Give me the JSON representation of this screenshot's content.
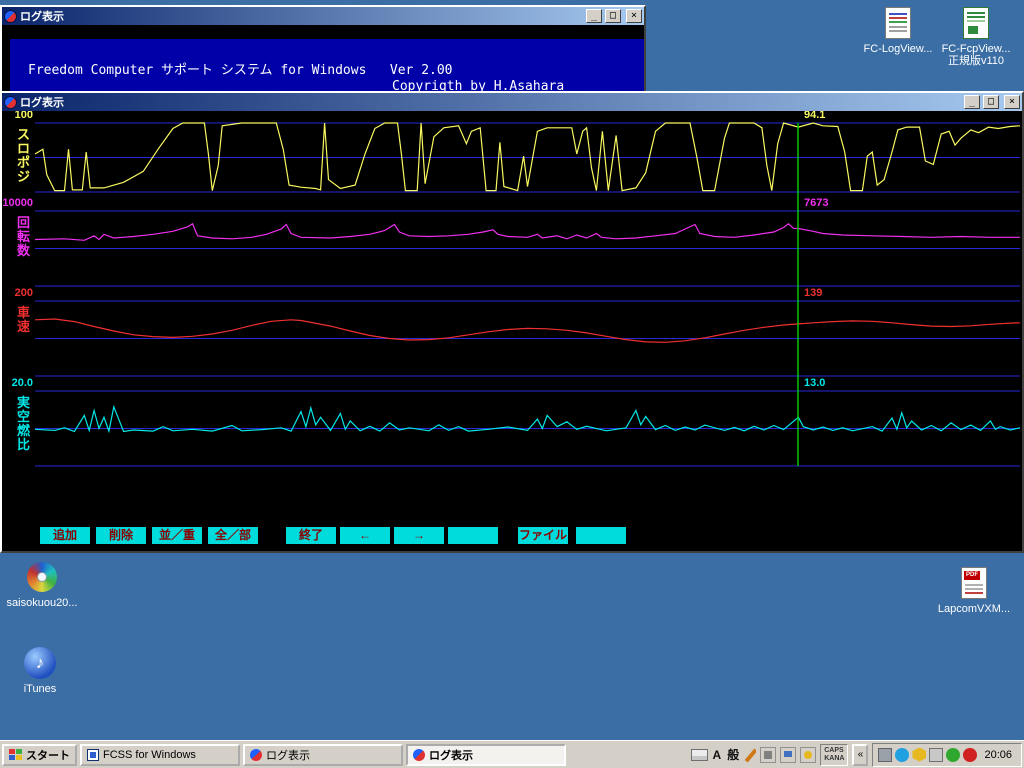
{
  "window_controls": {
    "minimize": "_",
    "maximize": "□",
    "close": "×"
  },
  "background_window": {
    "title": "ログ表示",
    "line1": "Freedom Computer サポート システム for Windows   Ver 2.00",
    "line2": "Copyrigth by H.Asahara"
  },
  "log_window": {
    "title": "ログ表示",
    "cursor_frac": 0.7746,
    "buttons": [
      "追加",
      "削除",
      "並／重",
      "全／部",
      "終了",
      "←",
      "→",
      "",
      "ファイル",
      ""
    ]
  },
  "chart_data": [
    {
      "type": "line",
      "name": "スロポジ",
      "axis_chars": [
        "ス",
        "ロ",
        "ポ",
        "ジ"
      ],
      "color": "#F8F860",
      "ymin": 0,
      "ymax": 100,
      "max_label": "100",
      "cursor_value": "94.1",
      "points": [
        [
          0,
          55
        ],
        [
          0.008,
          62
        ],
        [
          0.012,
          25
        ],
        [
          0.02,
          2
        ],
        [
          0.03,
          2
        ],
        [
          0.034,
          62
        ],
        [
          0.038,
          3
        ],
        [
          0.048,
          3
        ],
        [
          0.052,
          58
        ],
        [
          0.056,
          6
        ],
        [
          0.07,
          6
        ],
        [
          0.09,
          14
        ],
        [
          0.11,
          30
        ],
        [
          0.125,
          62
        ],
        [
          0.14,
          92
        ],
        [
          0.15,
          100
        ],
        [
          0.172,
          100
        ],
        [
          0.176,
          55
        ],
        [
          0.18,
          2
        ],
        [
          0.186,
          38
        ],
        [
          0.19,
          96
        ],
        [
          0.21,
          100
        ],
        [
          0.245,
          100
        ],
        [
          0.252,
          62
        ],
        [
          0.258,
          10
        ],
        [
          0.27,
          7
        ],
        [
          0.285,
          5
        ],
        [
          0.29,
          3
        ],
        [
          0.294,
          100
        ],
        [
          0.298,
          18
        ],
        [
          0.31,
          5
        ],
        [
          0.325,
          10
        ],
        [
          0.335,
          55
        ],
        [
          0.345,
          92
        ],
        [
          0.355,
          100
        ],
        [
          0.368,
          100
        ],
        [
          0.372,
          55
        ],
        [
          0.376,
          2
        ],
        [
          0.388,
          2
        ],
        [
          0.392,
          100
        ],
        [
          0.396,
          12
        ],
        [
          0.405,
          80
        ],
        [
          0.415,
          93
        ],
        [
          0.43,
          96
        ],
        [
          0.438,
          70
        ],
        [
          0.443,
          88
        ],
        [
          0.452,
          93
        ],
        [
          0.458,
          2
        ],
        [
          0.468,
          2
        ],
        [
          0.472,
          72
        ],
        [
          0.476,
          8
        ],
        [
          0.49,
          2
        ],
        [
          0.496,
          52
        ],
        [
          0.5,
          8
        ],
        [
          0.51,
          88
        ],
        [
          0.52,
          93
        ],
        [
          0.545,
          93
        ],
        [
          0.55,
          55
        ],
        [
          0.556,
          88
        ],
        [
          0.56,
          93
        ],
        [
          0.565,
          35
        ],
        [
          0.57,
          2
        ],
        [
          0.576,
          88
        ],
        [
          0.582,
          2
        ],
        [
          0.59,
          82
        ],
        [
          0.596,
          2
        ],
        [
          0.61,
          6
        ],
        [
          0.62,
          28
        ],
        [
          0.63,
          88
        ],
        [
          0.64,
          100
        ],
        [
          0.665,
          100
        ],
        [
          0.672,
          50
        ],
        [
          0.678,
          2
        ],
        [
          0.69,
          2
        ],
        [
          0.7,
          78
        ],
        [
          0.705,
          100
        ],
        [
          0.73,
          100
        ],
        [
          0.738,
          93
        ],
        [
          0.743,
          38
        ],
        [
          0.748,
          2
        ],
        [
          0.754,
          70
        ],
        [
          0.76,
          100
        ],
        [
          0.775,
          94
        ],
        [
          0.79,
          100
        ],
        [
          0.8,
          96
        ],
        [
          0.815,
          95
        ],
        [
          0.822,
          58
        ],
        [
          0.828,
          2
        ],
        [
          0.84,
          2
        ],
        [
          0.845,
          52
        ],
        [
          0.85,
          58
        ],
        [
          0.855,
          10
        ],
        [
          0.862,
          18
        ],
        [
          0.87,
          58
        ],
        [
          0.876,
          90
        ],
        [
          0.885,
          94
        ],
        [
          0.898,
          94
        ],
        [
          0.904,
          45
        ],
        [
          0.912,
          40
        ],
        [
          0.92,
          84
        ],
        [
          0.928,
          88
        ],
        [
          0.934,
          68
        ],
        [
          0.94,
          78
        ],
        [
          0.95,
          90
        ],
        [
          0.958,
          86
        ],
        [
          0.968,
          94
        ],
        [
          0.978,
          92
        ],
        [
          0.99,
          95
        ],
        [
          1,
          96
        ]
      ]
    },
    {
      "type": "line",
      "name": "回転数",
      "axis_chars": [
        "回",
        "転",
        "数"
      ],
      "color": "#F030F0",
      "ymin": 0,
      "ymax": 10000,
      "max_label": "10000",
      "cursor_value": "7673",
      "points": [
        [
          0,
          6200
        ],
        [
          0.03,
          6300
        ],
        [
          0.05,
          6100
        ],
        [
          0.06,
          6700
        ],
        [
          0.065,
          6200
        ],
        [
          0.07,
          6900
        ],
        [
          0.08,
          6400
        ],
        [
          0.1,
          6600
        ],
        [
          0.12,
          6900
        ],
        [
          0.14,
          7300
        ],
        [
          0.155,
          7900
        ],
        [
          0.16,
          8300
        ],
        [
          0.165,
          6700
        ],
        [
          0.18,
          6400
        ],
        [
          0.2,
          6300
        ],
        [
          0.22,
          6500
        ],
        [
          0.235,
          6900
        ],
        [
          0.25,
          7600
        ],
        [
          0.255,
          8200
        ],
        [
          0.26,
          7000
        ],
        [
          0.27,
          6500
        ],
        [
          0.3,
          6400
        ],
        [
          0.32,
          6600
        ],
        [
          0.34,
          6900
        ],
        [
          0.355,
          7400
        ],
        [
          0.365,
          8200
        ],
        [
          0.37,
          7200
        ],
        [
          0.38,
          6700
        ],
        [
          0.4,
          6600
        ],
        [
          0.42,
          6700
        ],
        [
          0.44,
          6900
        ],
        [
          0.455,
          7200
        ],
        [
          0.465,
          7500
        ],
        [
          0.47,
          6900
        ],
        [
          0.48,
          6600
        ],
        [
          0.5,
          6500
        ],
        [
          0.51,
          6900
        ],
        [
          0.515,
          6400
        ],
        [
          0.53,
          6700
        ],
        [
          0.54,
          6300
        ],
        [
          0.55,
          6800
        ],
        [
          0.56,
          6400
        ],
        [
          0.57,
          7000
        ],
        [
          0.575,
          6500
        ],
        [
          0.59,
          6300
        ],
        [
          0.61,
          6400
        ],
        [
          0.63,
          6700
        ],
        [
          0.65,
          7000
        ],
        [
          0.66,
          7600
        ],
        [
          0.67,
          8200
        ],
        [
          0.675,
          7000
        ],
        [
          0.69,
          6600
        ],
        [
          0.71,
          6500
        ],
        [
          0.73,
          6800
        ],
        [
          0.75,
          7200
        ],
        [
          0.76,
          7800
        ],
        [
          0.765,
          8300
        ],
        [
          0.77,
          7700
        ],
        [
          0.775,
          7673
        ],
        [
          0.79,
          7300
        ],
        [
          0.8,
          7000
        ],
        [
          0.82,
          6800
        ],
        [
          0.85,
          6700
        ],
        [
          0.88,
          6600
        ],
        [
          0.91,
          6500
        ],
        [
          0.94,
          6600
        ],
        [
          0.97,
          6500
        ],
        [
          1,
          6500
        ]
      ]
    },
    {
      "type": "line",
      "name": "車速",
      "axis_chars": [
        "車",
        "速"
      ],
      "color": "#F03030",
      "ymin": 0,
      "ymax": 200,
      "max_label": "200",
      "cursor_value": "139",
      "points": [
        [
          0,
          150
        ],
        [
          0.02,
          152
        ],
        [
          0.04,
          145
        ],
        [
          0.06,
          132
        ],
        [
          0.08,
          120
        ],
        [
          0.1,
          110
        ],
        [
          0.12,
          105
        ],
        [
          0.14,
          103
        ],
        [
          0.16,
          106
        ],
        [
          0.18,
          112
        ],
        [
          0.2,
          122
        ],
        [
          0.22,
          135
        ],
        [
          0.24,
          146
        ],
        [
          0.26,
          150
        ],
        [
          0.27,
          148
        ],
        [
          0.28,
          143
        ],
        [
          0.3,
          133
        ],
        [
          0.32,
          120
        ],
        [
          0.34,
          108
        ],
        [
          0.36,
          100
        ],
        [
          0.38,
          96
        ],
        [
          0.4,
          97
        ],
        [
          0.42,
          102
        ],
        [
          0.44,
          110
        ],
        [
          0.46,
          118
        ],
        [
          0.48,
          124
        ],
        [
          0.5,
          127
        ],
        [
          0.52,
          126
        ],
        [
          0.54,
          122
        ],
        [
          0.56,
          115
        ],
        [
          0.58,
          106
        ],
        [
          0.6,
          97
        ],
        [
          0.62,
          91
        ],
        [
          0.64,
          90
        ],
        [
          0.66,
          94
        ],
        [
          0.68,
          102
        ],
        [
          0.7,
          112
        ],
        [
          0.72,
          122
        ],
        [
          0.74,
          130
        ],
        [
          0.76,
          136
        ],
        [
          0.775,
          139
        ],
        [
          0.79,
          142
        ],
        [
          0.81,
          145
        ],
        [
          0.83,
          147
        ],
        [
          0.85,
          146
        ],
        [
          0.87,
          142
        ],
        [
          0.89,
          137
        ],
        [
          0.91,
          133
        ],
        [
          0.93,
          132
        ],
        [
          0.95,
          134
        ],
        [
          0.97,
          138
        ],
        [
          0.99,
          141
        ],
        [
          1,
          142
        ]
      ]
    },
    {
      "type": "line",
      "name": "実空燃比",
      "axis_chars": [
        "実",
        "空",
        "燃",
        "比"
      ],
      "color": "#00E8E8",
      "ymin": 0,
      "ymax": 20,
      "max_label": "20.0",
      "cursor_value": "13.0",
      "points": [
        [
          0,
          9.8
        ],
        [
          0.02,
          9.5
        ],
        [
          0.03,
          10.2
        ],
        [
          0.04,
          9.2
        ],
        [
          0.05,
          13.5
        ],
        [
          0.055,
          9.5
        ],
        [
          0.06,
          14.8
        ],
        [
          0.065,
          10
        ],
        [
          0.07,
          13
        ],
        [
          0.075,
          9.3
        ],
        [
          0.08,
          15.8
        ],
        [
          0.09,
          9.2
        ],
        [
          0.1,
          9.6
        ],
        [
          0.12,
          9.3
        ],
        [
          0.13,
          10.5
        ],
        [
          0.14,
          9.4
        ],
        [
          0.16,
          9.8
        ],
        [
          0.18,
          9.3
        ],
        [
          0.2,
          10.8
        ],
        [
          0.21,
          9.4
        ],
        [
          0.23,
          9.7
        ],
        [
          0.25,
          10.2
        ],
        [
          0.26,
          9.3
        ],
        [
          0.27,
          14.5
        ],
        [
          0.275,
          10.5
        ],
        [
          0.28,
          15.5
        ],
        [
          0.285,
          11
        ],
        [
          0.29,
          13
        ],
        [
          0.3,
          9.5
        ],
        [
          0.31,
          14
        ],
        [
          0.315,
          9.8
        ],
        [
          0.32,
          12
        ],
        [
          0.33,
          9.4
        ],
        [
          0.34,
          10.6
        ],
        [
          0.35,
          9.3
        ],
        [
          0.36,
          11.5
        ],
        [
          0.37,
          9.6
        ],
        [
          0.38,
          10.2
        ],
        [
          0.4,
          9.4
        ],
        [
          0.41,
          11
        ],
        [
          0.42,
          9.5
        ],
        [
          0.43,
          10.5
        ],
        [
          0.44,
          9.3
        ],
        [
          0.46,
          9.8
        ],
        [
          0.48,
          10.4
        ],
        [
          0.5,
          9.5
        ],
        [
          0.51,
          12.5
        ],
        [
          0.515,
          10
        ],
        [
          0.52,
          13.5
        ],
        [
          0.53,
          10.5
        ],
        [
          0.54,
          11.8
        ],
        [
          0.55,
          9.8
        ],
        [
          0.56,
          10.6
        ],
        [
          0.58,
          9.4
        ],
        [
          0.6,
          10.2
        ],
        [
          0.61,
          14.8
        ],
        [
          0.615,
          11
        ],
        [
          0.62,
          13.2
        ],
        [
          0.63,
          9.7
        ],
        [
          0.64,
          10.8
        ],
        [
          0.65,
          9.5
        ],
        [
          0.66,
          10.4
        ],
        [
          0.67,
          9.6
        ],
        [
          0.68,
          10.9
        ],
        [
          0.7,
          9.5
        ],
        [
          0.71,
          10.3
        ],
        [
          0.72,
          9.4
        ],
        [
          0.73,
          10.6
        ],
        [
          0.74,
          9.6
        ],
        [
          0.75,
          10.8
        ],
        [
          0.76,
          9.7
        ],
        [
          0.775,
          13
        ],
        [
          0.78,
          10.5
        ],
        [
          0.79,
          9.6
        ],
        [
          0.8,
          10.4
        ],
        [
          0.81,
          9.5
        ],
        [
          0.82,
          10.2
        ],
        [
          0.83,
          9.4
        ],
        [
          0.85,
          10.5
        ],
        [
          0.86,
          9.3
        ],
        [
          0.87,
          12.8
        ],
        [
          0.875,
          9.8
        ],
        [
          0.88,
          14.2
        ],
        [
          0.885,
          10.2
        ],
        [
          0.89,
          12
        ],
        [
          0.9,
          9.6
        ],
        [
          0.91,
          10.8
        ],
        [
          0.92,
          9.4
        ],
        [
          0.93,
          11.5
        ],
        [
          0.94,
          9.7
        ],
        [
          0.95,
          10.9
        ],
        [
          0.96,
          9.5
        ],
        [
          0.97,
          12
        ],
        [
          0.975,
          9.8
        ],
        [
          0.98,
          10.5
        ],
        [
          0.99,
          9.6
        ],
        [
          1,
          10.2
        ]
      ]
    }
  ],
  "desktop": {
    "icons": [
      {
        "id": "fc-logview",
        "label": "FC-LogView..."
      },
      {
        "id": "fc-fcpview",
        "label": "FC-FcpView...",
        "label2": "正規版v110"
      },
      {
        "id": "saisokuou",
        "label": "saisokuou20..."
      },
      {
        "id": "itunes",
        "label": "iTunes",
        "glyph": "♪"
      },
      {
        "id": "lapcom",
        "label": "LapcomVXM...",
        "badge": "PDF"
      }
    ]
  },
  "taskbar": {
    "start_label": "スタート",
    "tasks": [
      {
        "label": "FCSS for Windows",
        "icon": "app",
        "active": false
      },
      {
        "label": "ログ表示",
        "icon": "log",
        "active": false
      },
      {
        "label": "ログ表示",
        "icon": "log",
        "active": true
      }
    ],
    "ime": {
      "a": "A",
      "gen": "般",
      "caps": "CAPS",
      "kana": "KANA"
    },
    "chevron": "«",
    "clock": "20:06"
  }
}
